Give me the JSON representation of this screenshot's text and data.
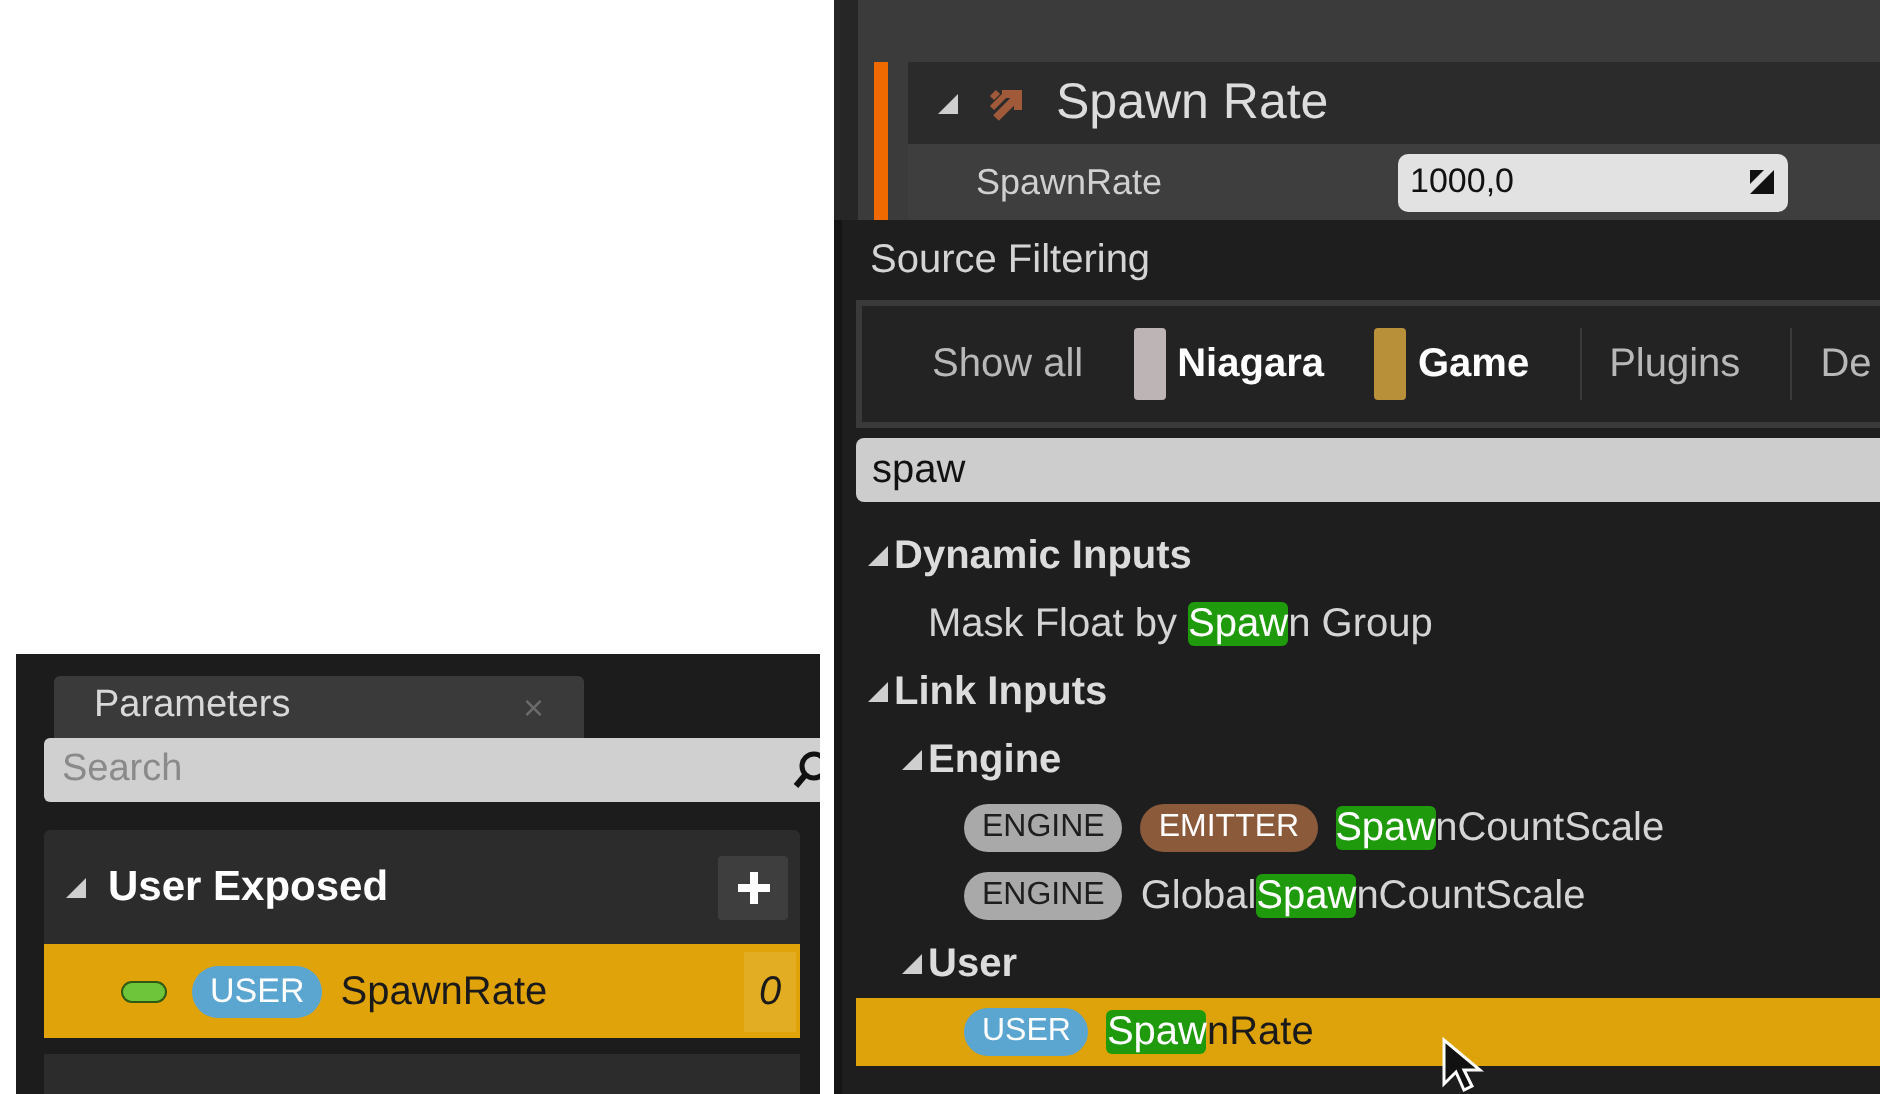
{
  "parameters_panel": {
    "tab": {
      "label": "Parameters",
      "close": "×"
    },
    "search": {
      "placeholder": "Search"
    },
    "sections": [
      {
        "title": "User Exposed",
        "expanded": true,
        "items": [
          {
            "tag": {
              "label": "USER",
              "color": "#5aa6d0"
            },
            "name": "SpawnRate",
            "value": "0",
            "selected": true
          }
        ]
      }
    ]
  },
  "module": {
    "title": "Spawn Rate",
    "expanded": true,
    "inputs": [
      {
        "label": "SpawnRate",
        "value": "1000,0"
      }
    ]
  },
  "popup": {
    "title": "Source Filtering",
    "filters": [
      {
        "label": "Show all",
        "kind": "plain",
        "active": false
      },
      {
        "label": "Niagara",
        "kind": "swatch",
        "color": "#bdb5b5",
        "active": true
      },
      {
        "label": "Game",
        "kind": "swatch",
        "color": "#b8903a",
        "active": true
      },
      {
        "label": "Plugins",
        "kind": "plain",
        "active": false
      },
      {
        "label": "De",
        "kind": "plain",
        "active": false
      }
    ],
    "search": {
      "value": "spaw"
    },
    "tree": [
      {
        "label": "Dynamic Inputs",
        "expanded": true,
        "children": [
          {
            "before": "Mask Float by ",
            "match": "Spaw",
            "after": "n Group",
            "selected": false
          }
        ]
      },
      {
        "label": "Link Inputs",
        "expanded": true,
        "children": [
          {
            "label": "Engine",
            "expanded": true,
            "children": [
              {
                "tags": [
                  {
                    "label": "ENGINE",
                    "color": "#a9a9a9"
                  },
                  {
                    "label": "EMITTER",
                    "color": "#8a5a3a"
                  }
                ],
                "match": "Spaw",
                "after": "nCountScale",
                "selected": false
              },
              {
                "tags": [
                  {
                    "label": "ENGINE",
                    "color": "#a9a9a9"
                  }
                ],
                "before": "Global",
                "match": "Spaw",
                "after": "nCountScale",
                "selected": false
              }
            ]
          },
          {
            "label": "User",
            "expanded": true,
            "children": [
              {
                "tags": [
                  {
                    "label": "USER",
                    "color": "#5aa6d0"
                  }
                ],
                "match": "Spaw",
                "after": "nRate",
                "selected": true
              }
            ]
          }
        ]
      }
    ]
  }
}
